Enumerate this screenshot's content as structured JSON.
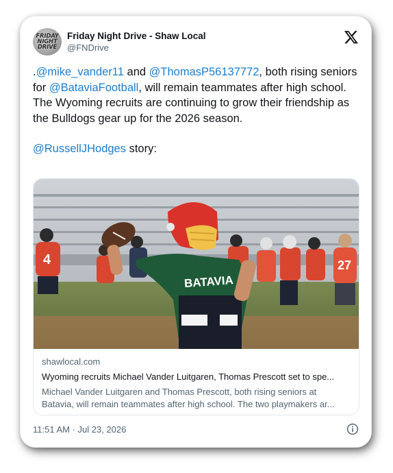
{
  "author": {
    "name": "Friday Night Drive - Shaw Local",
    "handle": "@FNDrive",
    "avatar_lines": [
      "FRIDAY",
      "NIGHT",
      "DRIVE"
    ]
  },
  "tweet": {
    "line1": [
      {
        "text": ".",
        "mention": false
      },
      {
        "text": "@mike_vander11",
        "mention": true
      },
      {
        "text": " and ",
        "mention": false
      },
      {
        "text": "@ThomasP56137772",
        "mention": true
      },
      {
        "text": ", both rising seniors for ",
        "mention": false
      },
      {
        "text": "@BataviaFootball",
        "mention": true
      },
      {
        "text": ", will remain teammates after high school. The Wyoming recruits are continuing to grow their friendship as the Bulldogs gear up for the 2026 season.",
        "mention": false
      }
    ],
    "line2": [
      {
        "text": "@RussellJHodges",
        "mention": true
      },
      {
        "text": " story:",
        "mention": false
      }
    ]
  },
  "link_card": {
    "domain": "shawlocal.com",
    "title": "Wyoming recruits Michael Vander Luitgaren, Thomas Prescott set to spe...",
    "desc_line1": "Michael Vander Luitgaren and Thomas Prescott, both rising seniors at",
    "desc_line2": "Batavia, will remain teammates after high school. The two playmakers ar...",
    "image_jersey_text": "BATAVIA",
    "image_numbers": [
      "4",
      "27"
    ]
  },
  "footer": {
    "timestamp": "11:51 AM · Jul 23, 2026"
  },
  "colors": {
    "mention": "#1d7ecf",
    "text": "#0f1419",
    "muted": "#536471"
  },
  "icons": [
    "x-logo-icon",
    "info-icon"
  ]
}
